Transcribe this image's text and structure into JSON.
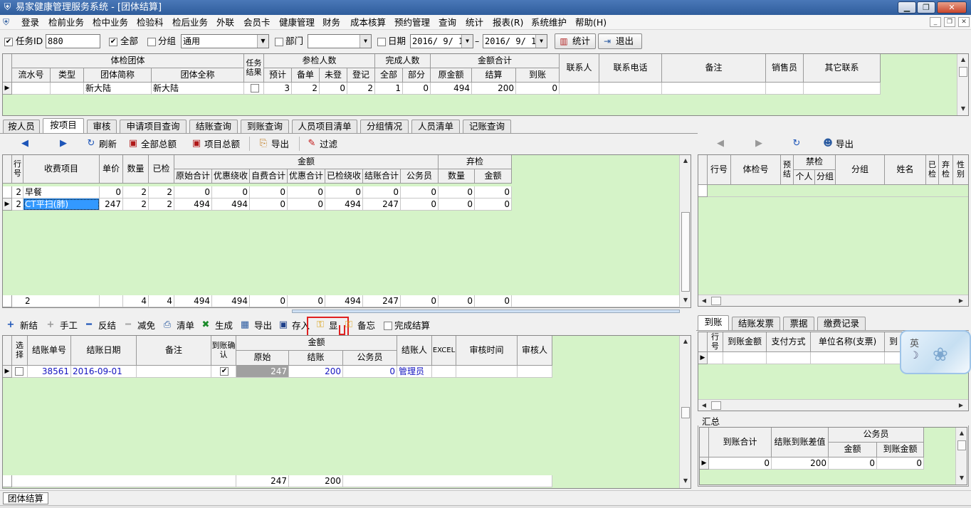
{
  "window": {
    "title": "易家健康管理服务系统 - [团体结算]",
    "min": "▁",
    "restore": "❐",
    "close": "✕"
  },
  "menu": [
    "登录",
    "检前业务",
    "检中业务",
    "检验科",
    "检后业务",
    "外联",
    "会员卡",
    "健康管理",
    "财务",
    "成本核算",
    "预约管理",
    "查询",
    "统计",
    "报表(R)",
    "系统维护",
    "帮助(H)"
  ],
  "toolbar": {
    "task_id_label": "任务ID",
    "task_id_value": "880",
    "all_label": "全部",
    "group_label": "分组",
    "group_value": "通用",
    "dept_label": "部门",
    "dept_value": "",
    "date_label": "日期",
    "date_from": "2016/ 9/ 1",
    "dash": "–",
    "date_to": "2016/ 9/ 1",
    "stats": "统计",
    "exit": "退出"
  },
  "top_grid": {
    "group_headers": [
      "体检团体",
      "参检人数",
      "完成人数",
      "金额合计"
    ],
    "task_result": "任务结果",
    "cols": [
      "流水号",
      "类型",
      "团体简称",
      "团体全称",
      "预计",
      "备单",
      "未登",
      "登记",
      "全部",
      "部分",
      "原金额",
      "结算",
      "到账",
      "联系人",
      "联系电话",
      "备注",
      "销售员",
      "其它联系"
    ],
    "row": {
      "serial": "",
      "type": "",
      "short": "新大陆",
      "full": "新大陆",
      "plan": "3",
      "prep": "2",
      "unreg": "0",
      "reg": "2",
      "all": "1",
      "part": "0",
      "orig": "494",
      "settle": "200",
      "arrive": "0"
    }
  },
  "tabs": [
    "按人员",
    "按项目",
    "审核",
    "申请项目查询",
    "结账查询",
    "到账查询",
    "人员项目清单",
    "分组情况",
    "人员清单",
    "记账查询"
  ],
  "mid_toolbar": {
    "refresh": "刷新",
    "total_all": "全部总额",
    "total_item": "项目总额",
    "export": "导出",
    "filter": "过滤"
  },
  "items_grid": {
    "group_amount": "金额",
    "group_drop": "弃检",
    "cols": [
      "行号",
      "收费项目",
      "单价",
      "数量",
      "已检",
      "原始合计",
      "优惠绕收",
      "自费合计",
      "优惠合计",
      "已检绕收",
      "结账合计",
      "公务员",
      "数量",
      "金额"
    ],
    "rows": [
      [
        "2",
        "早餐",
        "0",
        "2",
        "2",
        "0",
        "0",
        "0",
        "0",
        "0",
        "0",
        "0",
        "0",
        "0"
      ],
      [
        "2",
        "CT平扫(肺)",
        "247",
        "2",
        "2",
        "494",
        "494",
        "0",
        "0",
        "494",
        "247",
        "0",
        "0",
        "0"
      ]
    ],
    "footer": [
      "2",
      "",
      "",
      "4",
      "4",
      "494",
      "494",
      "0",
      "0",
      "494",
      "247",
      "0",
      "0",
      "0"
    ]
  },
  "right_toolbar": {
    "export": "导出"
  },
  "right_grid": {
    "cols": [
      "行号",
      "体检号",
      "预结",
      "禁检",
      "个人",
      "分组",
      "分组",
      "姓名",
      "已检",
      "弃检",
      "性别"
    ]
  },
  "bottom_toolbar": {
    "new": "新结",
    "manual": "手工",
    "reverse": "反结",
    "reduce": "减免",
    "list": "清单",
    "generate": "生成",
    "export": "导出",
    "save": "存入",
    "show": "显",
    "memo": "备忘",
    "complete": "完成结算"
  },
  "settle_grid": {
    "group_amount": "金额",
    "cols": [
      "选择",
      "结账单号",
      "结账日期",
      "备注",
      "到账确认",
      "原始",
      "结账",
      "公务员",
      "结账人",
      "EXCEL",
      "审核时间",
      "审核人"
    ],
    "row": {
      "no": "38561",
      "date": "2016-09-01",
      "memo": "",
      "orig": "247",
      "settle": "200",
      "civil": "0",
      "user": "管理员"
    },
    "footer": {
      "orig": "247",
      "settle": "200"
    }
  },
  "right_tabs": [
    "到账",
    "结账发票",
    "票据",
    "缴费记录"
  ],
  "arrive_grid": {
    "cols": [
      "行号",
      "到账金额",
      "支付方式",
      "单位名称(支票)",
      "到"
    ]
  },
  "summary": {
    "label": "汇总",
    "cols": [
      "到账合计",
      "结账到账差值",
      "公务员",
      "金额",
      "到账金额"
    ],
    "row": [
      "0",
      "200",
      "0",
      "0"
    ]
  },
  "ime": {
    "text": "英"
  },
  "statusbar": {
    "tab": "团体结算"
  }
}
